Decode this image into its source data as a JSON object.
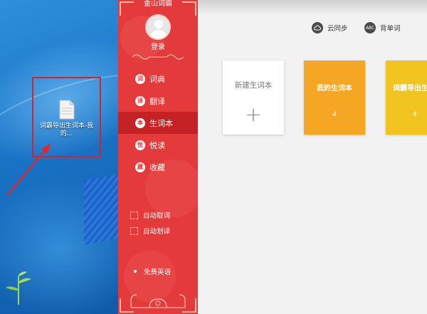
{
  "desktop": {
    "file": {
      "label": "词霸导出生词本-我的..."
    }
  },
  "sidebar": {
    "app_title": "金山词霸",
    "login_label": "登录",
    "items": [
      {
        "label": "词典",
        "icon": "dictionary-icon"
      },
      {
        "label": "翻译",
        "icon": "translate-icon"
      },
      {
        "label": "生词本",
        "icon": "wordbook-icon",
        "active": true
      },
      {
        "label": "悦读",
        "icon": "reading-icon"
      },
      {
        "label": "收藏",
        "icon": "favorites-icon"
      }
    ],
    "options": [
      {
        "label": "自动取词"
      },
      {
        "label": "自动划译"
      }
    ],
    "footer_link": "免费英语"
  },
  "header": {
    "sync_label": "云同步",
    "sync_icon": "cloud-icon",
    "recite_label": "背单词",
    "recite_icon_text": "ABC"
  },
  "wordbooks": {
    "new_title": "新建生词本",
    "new_symbol": "+",
    "cards": [
      {
        "title": "我的生词本",
        "count": "4",
        "color": "#f5a623"
      },
      {
        "title": "词霸导出生",
        "count": "4",
        "color": "#f2c41f"
      }
    ]
  },
  "colors": {
    "sidebar_bg": "#e53a3b",
    "sidebar_active": "#c42224",
    "highlight_border": "#d6222a",
    "main_bg": "#f2f2f2"
  }
}
